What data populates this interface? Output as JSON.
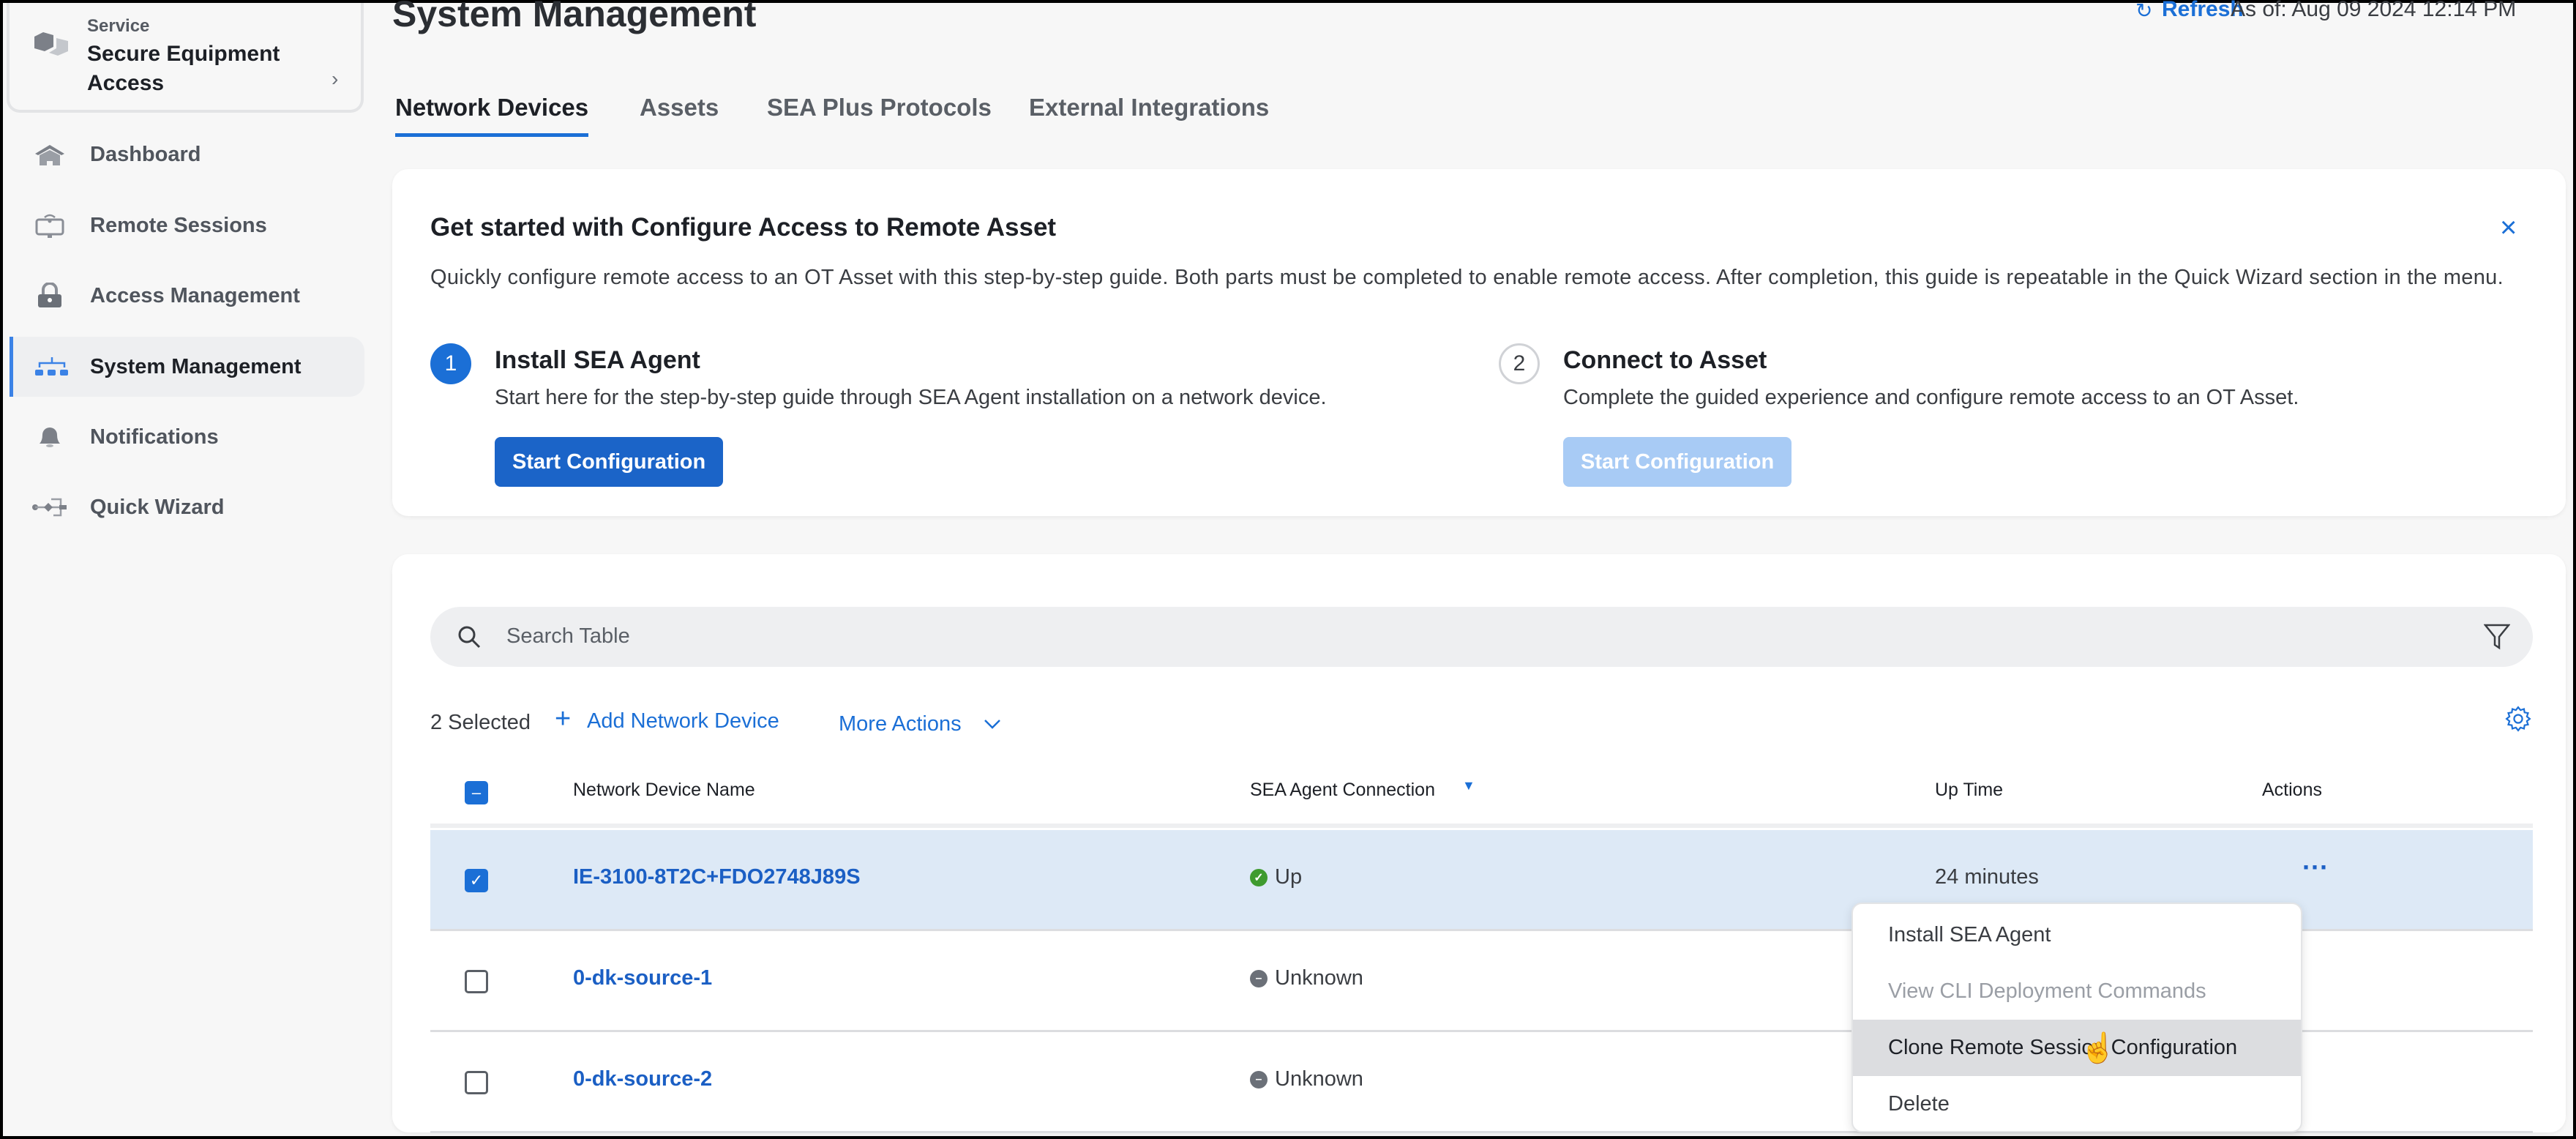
{
  "sidebar": {
    "service_label": "Service",
    "service_name": "Secure Equipment Access",
    "items": [
      {
        "label": "Dashboard",
        "icon": "home-icon"
      },
      {
        "label": "Remote Sessions",
        "icon": "remote-monitor-icon"
      },
      {
        "label": "Access Management",
        "icon": "lock-icon"
      },
      {
        "label": "System Management",
        "icon": "network-tree-icon",
        "active": true
      },
      {
        "label": "Notifications",
        "icon": "bell-icon"
      },
      {
        "label": "Quick Wizard",
        "icon": "workflow-icon"
      }
    ]
  },
  "header": {
    "title": "System Management",
    "refresh": "Refresh",
    "as_of": "As of: Aug 09 2024 12:14 PM"
  },
  "tabs": [
    "Network Devices",
    "Assets",
    "SEA Plus Protocols",
    "External Integrations"
  ],
  "guide": {
    "title": "Get started with Configure Access to Remote Asset",
    "description": "Quickly configure remote access to an OT Asset with this step-by-step guide. Both parts must be completed to enable remote access. After completion, this guide is repeatable in the Quick Wizard section in the menu.",
    "steps": [
      {
        "num": "1",
        "title": "Install SEA Agent",
        "text": "Start here for the step-by-step guide through SEA Agent installation on a network device.",
        "button": "Start Configuration"
      },
      {
        "num": "2",
        "title": "Connect to Asset",
        "text": "Complete the guided experience and configure remote access to an OT Asset.",
        "button": "Start Configuration"
      }
    ]
  },
  "table": {
    "search_placeholder": "Search Table",
    "selected": "2 Selected",
    "add": "Add Network Device",
    "more": "More Actions",
    "columns": [
      "Network Device Name",
      "SEA Agent Connection",
      "Up Time",
      "Actions"
    ],
    "rows": [
      {
        "name": "IE-3100-8T2C+FDO2748J89S",
        "status": "Up",
        "uptime": "24 minutes",
        "checked": true
      },
      {
        "name": "0-dk-source-1",
        "status": "Unknown",
        "uptime": "",
        "checked": false
      },
      {
        "name": "0-dk-source-2",
        "status": "Unknown",
        "uptime": "",
        "checked": false
      }
    ]
  },
  "menu": [
    "Install SEA Agent",
    "View CLI Deployment Commands",
    "Clone Remote Session Configuration",
    "Delete"
  ],
  "colors": {
    "accent": "#1b6fd6",
    "selected_row": "#dde9f6",
    "up": "#3f9b2f",
    "unknown": "#6b7078"
  }
}
